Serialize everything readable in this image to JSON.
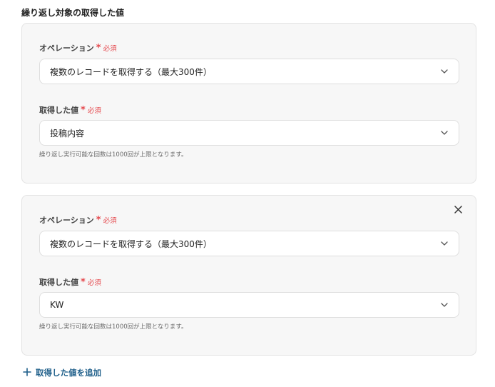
{
  "section_title": "繰り返し対象の取得した値",
  "required_star": "*",
  "required_text": "必須",
  "cards": [
    {
      "operation_label": "オペレーション",
      "operation_value": "複数のレコードを取得する（最大300件）",
      "value_label": "取得した値",
      "value_value": "投稿内容",
      "help_text": "繰り返し実行可能な回数は1000回が上限となります。"
    },
    {
      "operation_label": "オペレーション",
      "operation_value": "複数のレコードを取得する（最大300件）",
      "value_label": "取得した値",
      "value_value": "KW",
      "help_text": "繰り返し実行可能な回数は1000回が上限となります。"
    }
  ],
  "add_link_label": "取得した値を追加",
  "colors": {
    "required": "#e5484d",
    "link": "#1f5f8a",
    "card_bg": "#f7f7f7"
  }
}
